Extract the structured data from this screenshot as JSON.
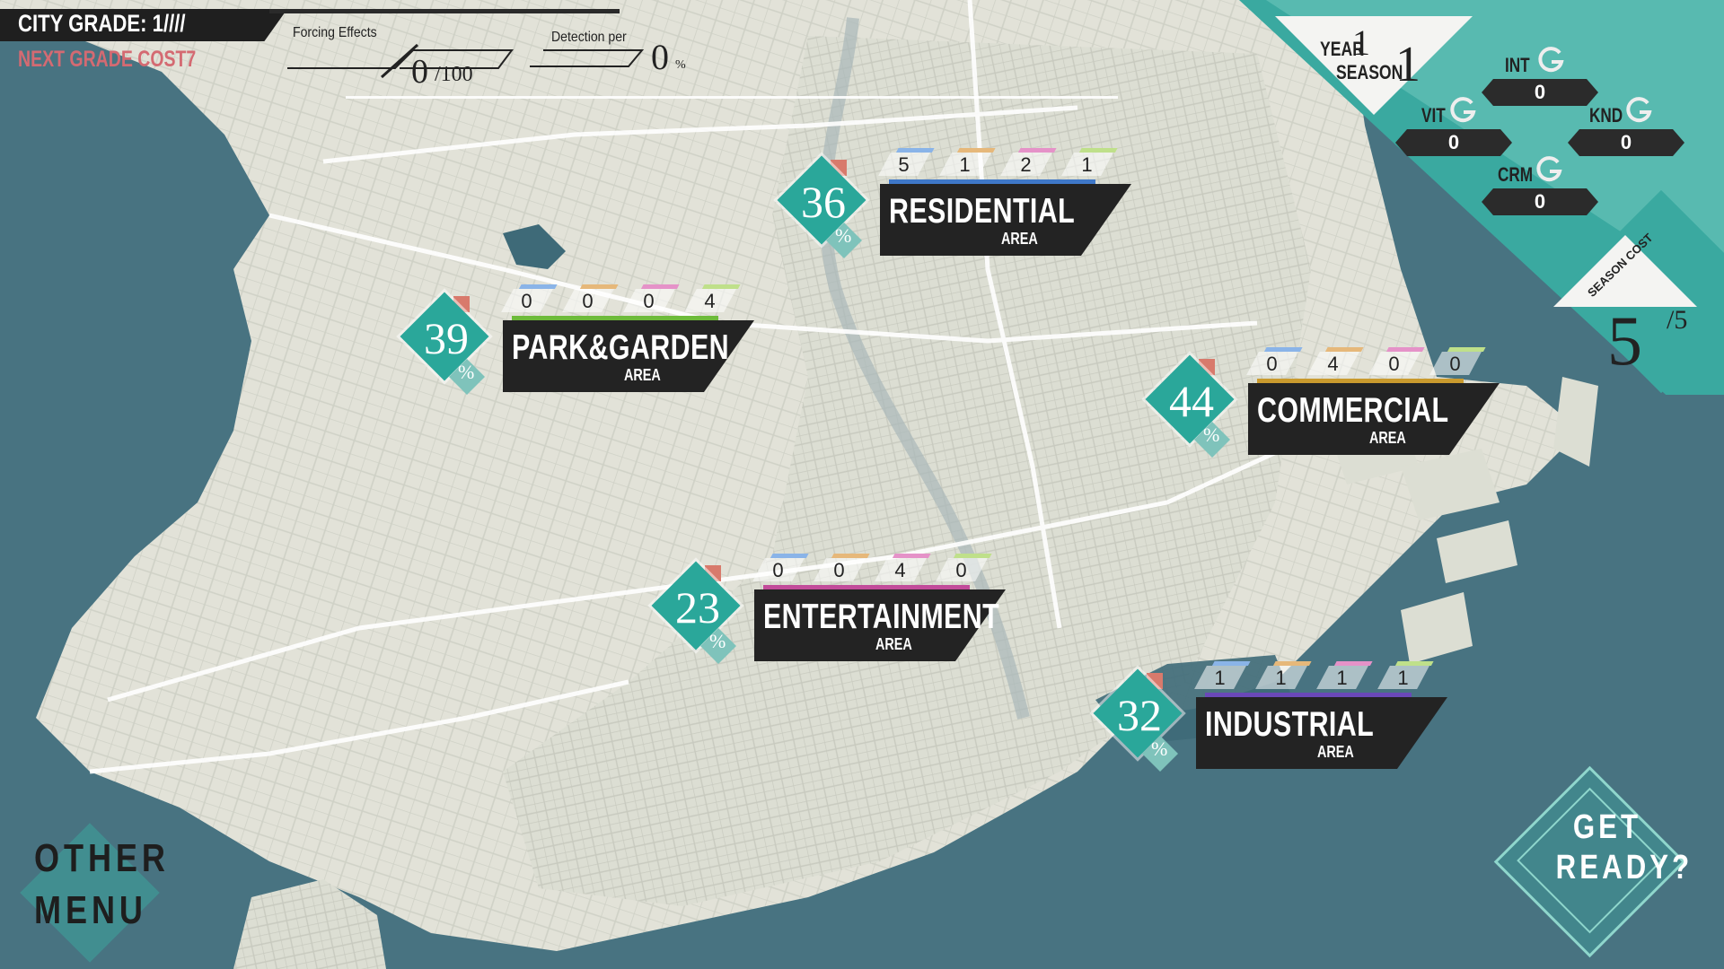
{
  "hud": {
    "city_grade": "CITY GRADE: 1////",
    "next_grade_cost": "NEXT GRADE COST7",
    "forcing_label": "Forcing Effects",
    "forcing_value": "0",
    "forcing_max": "/100",
    "detection_label": "Detection per",
    "detection_value": "0",
    "detection_unit": "%"
  },
  "time": {
    "year_label": "YEAR",
    "year_value": "1",
    "season_label": "SEASON",
    "season_value": "1"
  },
  "stats": {
    "int": {
      "label": "INT",
      "value": "0"
    },
    "vit": {
      "label": "VIT",
      "value": "0"
    },
    "knd": {
      "label": "KND",
      "value": "0"
    },
    "crm": {
      "label": "CRM",
      "value": "0"
    }
  },
  "season_cost": {
    "label": "SEASON COST",
    "value": "5",
    "max": "/5"
  },
  "areas": {
    "residential": {
      "percent": "36",
      "pct_sign": "%",
      "name": "RESIDENTIAL",
      "sub": "AREA",
      "counts": [
        "5",
        "1",
        "2",
        "1"
      ],
      "accent": "#3f78c8"
    },
    "park": {
      "percent": "39",
      "pct_sign": "%",
      "name": "PARK&GARDEN",
      "sub": "AREA",
      "counts": [
        "0",
        "0",
        "0",
        "4"
      ],
      "accent": "#6dbb3a"
    },
    "commercial": {
      "percent": "44",
      "pct_sign": "%",
      "name": "COMMERCIAL",
      "sub": "AREA",
      "counts": [
        "0",
        "4",
        "0",
        "0"
      ],
      "accent": "#c99a2e"
    },
    "entertainment": {
      "percent": "23",
      "pct_sign": "%",
      "name": "ENTERTAINMENT",
      "sub": "AREA",
      "counts": [
        "0",
        "0",
        "4",
        "0"
      ],
      "accent": "#c24c9a"
    },
    "industrial": {
      "percent": "32",
      "pct_sign": "%",
      "name": "INDUSTRIAL",
      "sub": "AREA",
      "counts": [
        "1",
        "1",
        "1",
        "1"
      ],
      "accent": "#6a48b8"
    }
  },
  "count_tab_colors": [
    "#8ab4e8",
    "#e6b87a",
    "#e592c8",
    "#bfe08a"
  ],
  "buttons": {
    "get_ready_1": "GET",
    "get_ready_2": "READY?",
    "other_menu_1": "OTHER",
    "other_menu_2": "MENU"
  },
  "colors": {
    "teal": "#3aa9a0",
    "land": "#e4e4da",
    "sea": "#3e6a78",
    "grade_cost": "#d46a72"
  }
}
